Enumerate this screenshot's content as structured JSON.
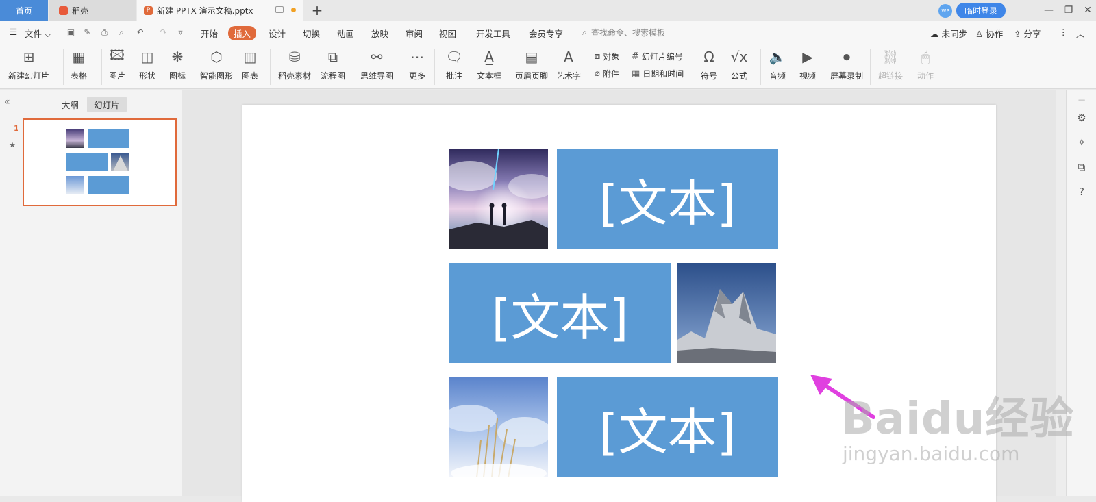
{
  "tabs": {
    "home": "首页",
    "daoke": "稻壳",
    "doc": "新建 PPTX 演示文稿.pptx",
    "add": "+",
    "ppt_badge": "P"
  },
  "account": {
    "avatar": "WP",
    "login": "临时登录"
  },
  "window": {
    "minimize": "—",
    "restore": "❐",
    "close": "✕"
  },
  "menu": {
    "file": "文件",
    "items": [
      "开始",
      "插入",
      "设计",
      "切换",
      "动画",
      "放映",
      "审阅",
      "视图",
      "开发工具",
      "会员专享"
    ],
    "search_placeholder": "查找命令、搜索模板",
    "sync": "未同步",
    "collab": "协作",
    "share": "分享"
  },
  "ribbon": {
    "new_slide": "新建幻灯片",
    "table": "表格",
    "picture": "图片",
    "shape": "形状",
    "icon": "图标",
    "smartart": "智能图形",
    "chart": "图表",
    "daoke_material": "稻壳素材",
    "flowchart": "流程图",
    "mindmap": "思维导图",
    "more": "更多",
    "comment": "批注",
    "textbox": "文本框",
    "header_footer": "页眉页脚",
    "wordart": "艺术字",
    "object": "对象",
    "slide_number": "幻灯片编号",
    "attachment": "附件",
    "datetime": "日期和时间",
    "symbol": "符号",
    "formula": "公式",
    "audio": "音频",
    "video": "视频",
    "screen_record": "屏幕录制",
    "hyperlink": "超链接",
    "action": "动作"
  },
  "left_panel": {
    "outline_tab": "大纲",
    "slides_tab": "幻灯片",
    "slide_number": "1",
    "star": "★"
  },
  "slide": {
    "text1": "[文本]",
    "text2": "[文本]",
    "text3": "[文本]"
  },
  "watermark": {
    "brand": "Baidu经验",
    "url": "jingyan.baidu.com"
  },
  "colors": {
    "accent": "#e06a3b",
    "textbox": "#5b9bd5",
    "home_tab": "#4a8bd8",
    "arrow": "#e040e0"
  }
}
